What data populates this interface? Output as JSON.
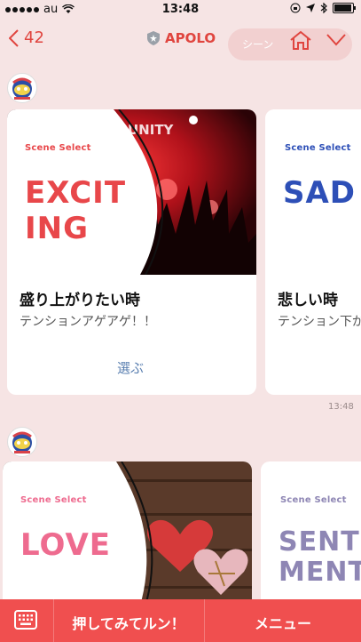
{
  "status": {
    "carrier": "au",
    "time": "13:48"
  },
  "nav": {
    "back_count": "42",
    "title": "APOLO",
    "pill_text": "シーン"
  },
  "cards_row1": [
    {
      "scene_label": "Scene Select",
      "big_text": "EXCIT\nING",
      "title": "盛り上がりたい時",
      "subtitle": "テンションアゲアゲ！！",
      "button": "選ぶ",
      "photo_text": "UNITY"
    },
    {
      "scene_label": "Scene Select",
      "big_text": "SAD",
      "title": "悲しい時",
      "subtitle": "テンション下が"
    }
  ],
  "timestamp1": "13:48",
  "cards_row2": [
    {
      "scene_label": "Scene Select",
      "big_text": "LOVE"
    },
    {
      "scene_label": "Scene Select",
      "big_text": "SENTI\nMENTA"
    }
  ],
  "bottom": {
    "push_label": "押してみてルン！",
    "menu_label": "メニュー"
  },
  "colors": {
    "accent": "#e0453f",
    "excite": "#e8474a",
    "sad": "#2d4fb7",
    "love": "#ee6b8f",
    "senti": "#8e86b4"
  }
}
